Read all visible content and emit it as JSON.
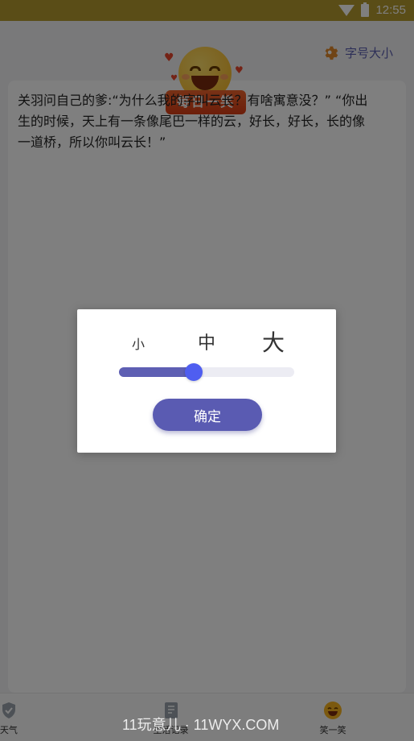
{
  "status_bar": {
    "time": "12:55",
    "icons": [
      "wifi-icon",
      "battery-icon"
    ]
  },
  "header": {
    "font_size_link": "字号大小",
    "icon": "gear-icon"
  },
  "hero": {
    "badge": "每日一笑",
    "icon": "laughing-emoji-icon"
  },
  "joke": {
    "text": "关羽问自己的爹:“为什么我的字叫云长？有啥寓意没？” “你出生的时候，天上有一条像尾巴一样的云，好长，好长，长的像一道桥，所以你叫云长！”"
  },
  "dialog": {
    "size_small": "小",
    "size_medium": "中",
    "size_large": "大",
    "slider_value": 0.4,
    "confirm_label": "确定"
  },
  "bottom_nav": [
    {
      "label": "天气",
      "icon": "shield-icon"
    },
    {
      "label": "生活记录",
      "icon": "notebook-icon"
    },
    {
      "label": "笑一笑",
      "icon": "laughing-emoji-icon"
    }
  ],
  "watermark": "11玩意儿 · 11WYX.COM",
  "colors": {
    "accent": "#5a5bb2",
    "status_bar": "#b59a2e",
    "badge": "#e24f22",
    "slider_thumb": "#4f5ef0"
  }
}
